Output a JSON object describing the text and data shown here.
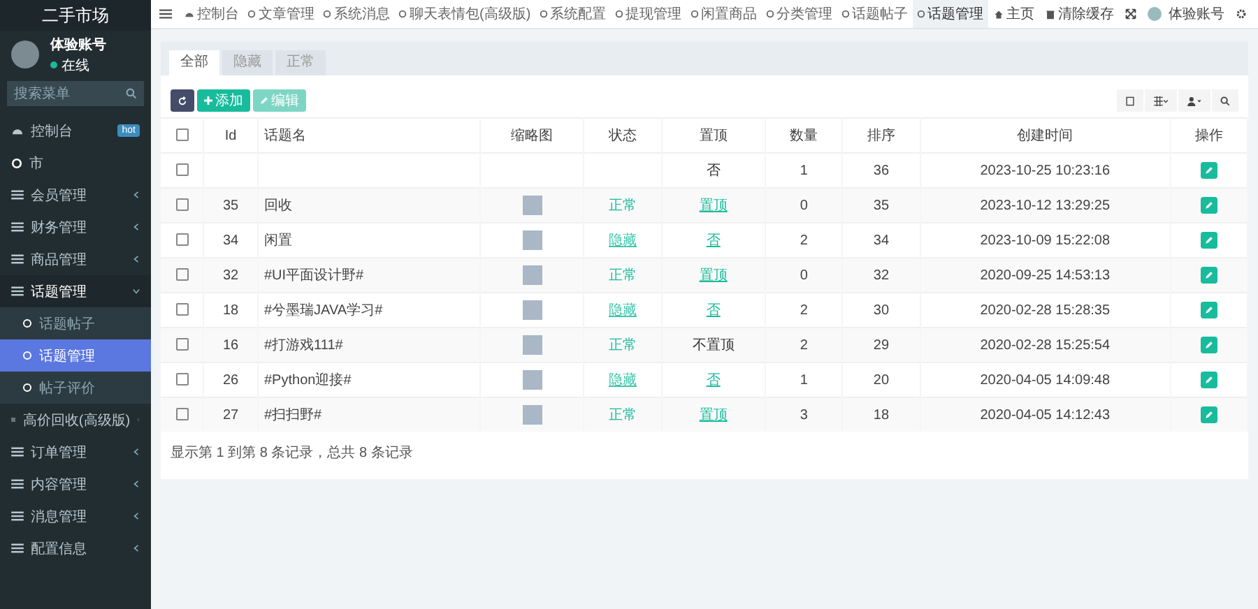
{
  "sidebar": {
    "logo": "二手市场",
    "user": {
      "name": "体验账号",
      "status": "在线"
    },
    "search": {
      "placeholder": "搜索菜单"
    },
    "items": [
      {
        "label": "控制台",
        "kind": "dashboard",
        "badge": "hot",
        "selected": false
      },
      {
        "label": "市",
        "kind": "page",
        "selected": false
      },
      {
        "label": "会员管理",
        "kind": "group",
        "selected": false,
        "expanded": false
      },
      {
        "label": "财务管理",
        "kind": "group",
        "selected": false,
        "expanded": false
      },
      {
        "label": "商品管理",
        "kind": "group",
        "selected": false,
        "expanded": false
      },
      {
        "label": "话题管理",
        "kind": "group",
        "selected": false,
        "expanded": true,
        "children": [
          {
            "label": "话题帖子",
            "selected": false
          },
          {
            "label": "话题管理",
            "selected": true
          },
          {
            "label": "帖子评价",
            "selected": false
          }
        ]
      },
      {
        "label": "高价回收(高级版)",
        "kind": "group",
        "selected": false,
        "expanded": false
      },
      {
        "label": "订单管理",
        "kind": "group",
        "selected": false,
        "expanded": false
      },
      {
        "label": "内容管理",
        "kind": "group",
        "selected": false,
        "expanded": false
      },
      {
        "label": "消息管理",
        "kind": "group",
        "selected": false,
        "expanded": false
      },
      {
        "label": "配置信息",
        "kind": "group",
        "selected": false,
        "expanded": false
      }
    ]
  },
  "topnav": {
    "tabs": [
      {
        "label": "控制台",
        "kind": "dashboard",
        "selected": false
      },
      {
        "label": "文章管理",
        "kind": "page",
        "selected": false
      },
      {
        "label": "系统消息",
        "kind": "page",
        "selected": false
      },
      {
        "label": "聊天表情包(高级版)",
        "kind": "page",
        "selected": false
      },
      {
        "label": "系统配置",
        "kind": "page",
        "selected": false
      },
      {
        "label": "提现管理",
        "kind": "page",
        "selected": false
      },
      {
        "label": "闲置商品",
        "kind": "page",
        "selected": false
      },
      {
        "label": "分类管理",
        "kind": "page",
        "selected": false
      },
      {
        "label": "话题帖子",
        "kind": "page",
        "selected": false
      },
      {
        "label": "话题管理",
        "kind": "page",
        "selected": true
      }
    ],
    "home": "主页",
    "clear_cache": "清除缓存",
    "account": "体验账号"
  },
  "filter_tabs": [
    {
      "label": "全部",
      "selected": true
    },
    {
      "label": "隐藏",
      "selected": false
    },
    {
      "label": "正常",
      "selected": false
    }
  ],
  "toolbar": {
    "add": "添加",
    "edit": "编辑",
    "edit_disabled": true
  },
  "table": {
    "select_all": false,
    "columns": [
      "Id",
      "话题名",
      "缩略图",
      "状态",
      "置顶",
      "数量",
      "排序",
      "创建时间",
      "操作"
    ],
    "rows": [
      {
        "checked": false,
        "thumbnail": false,
        "top": {
          "text": "否",
          "kind": "plain"
        },
        "count": "1",
        "sort": "36",
        "created": "2023-10-25 10:23:16"
      },
      {
        "checked": false,
        "id": "35",
        "name": "回收",
        "thumbnail": true,
        "status": {
          "text": "正常",
          "kind": "normal"
        },
        "top": {
          "text": "置顶",
          "kind": "link"
        },
        "count": "0",
        "sort": "35",
        "created": "2023-10-12 13:29:25"
      },
      {
        "checked": false,
        "id": "34",
        "name": "闲置",
        "thumbnail": true,
        "status": {
          "text": "隐藏",
          "kind": "hidden"
        },
        "top": {
          "text": "否",
          "kind": "link"
        },
        "count": "2",
        "sort": "34",
        "created": "2023-10-09 15:22:08"
      },
      {
        "checked": false,
        "id": "32",
        "name": "#UI平面设计野#",
        "thumbnail": true,
        "status": {
          "text": "正常",
          "kind": "normal"
        },
        "top": {
          "text": "置顶",
          "kind": "link"
        },
        "count": "0",
        "sort": "32",
        "created": "2020-09-25 14:53:13"
      },
      {
        "checked": false,
        "id": "18",
        "name": "#兮墨瑞JAVA学习#",
        "thumbnail": true,
        "status": {
          "text": "隐藏",
          "kind": "hidden"
        },
        "top": {
          "text": "否",
          "kind": "link"
        },
        "count": "2",
        "sort": "30",
        "created": "2020-02-28 15:28:35"
      },
      {
        "checked": false,
        "id": "16",
        "name": "#打游戏111#",
        "thumbnail": true,
        "status": {
          "text": "正常",
          "kind": "normal"
        },
        "top": {
          "text": "不置顶",
          "kind": "plain"
        },
        "count": "2",
        "sort": "29",
        "created": "2020-02-28 15:25:54"
      },
      {
        "checked": false,
        "id": "26",
        "name": "#Python迎接#",
        "thumbnail": true,
        "status": {
          "text": "隐藏",
          "kind": "hidden"
        },
        "top": {
          "text": "否",
          "kind": "link"
        },
        "count": "1",
        "sort": "20",
        "created": "2020-04-05 14:09:48"
      },
      {
        "checked": false,
        "id": "27",
        "name": "#扫扫野#",
        "thumbnail": true,
        "status": {
          "text": "正常",
          "kind": "normal"
        },
        "top": {
          "text": "置顶",
          "kind": "link"
        },
        "count": "3",
        "sort": "18",
        "created": "2020-04-05 14:12:43"
      }
    ],
    "footer": "显示第 1 到第 8 条记录，总共 8 条记录"
  }
}
